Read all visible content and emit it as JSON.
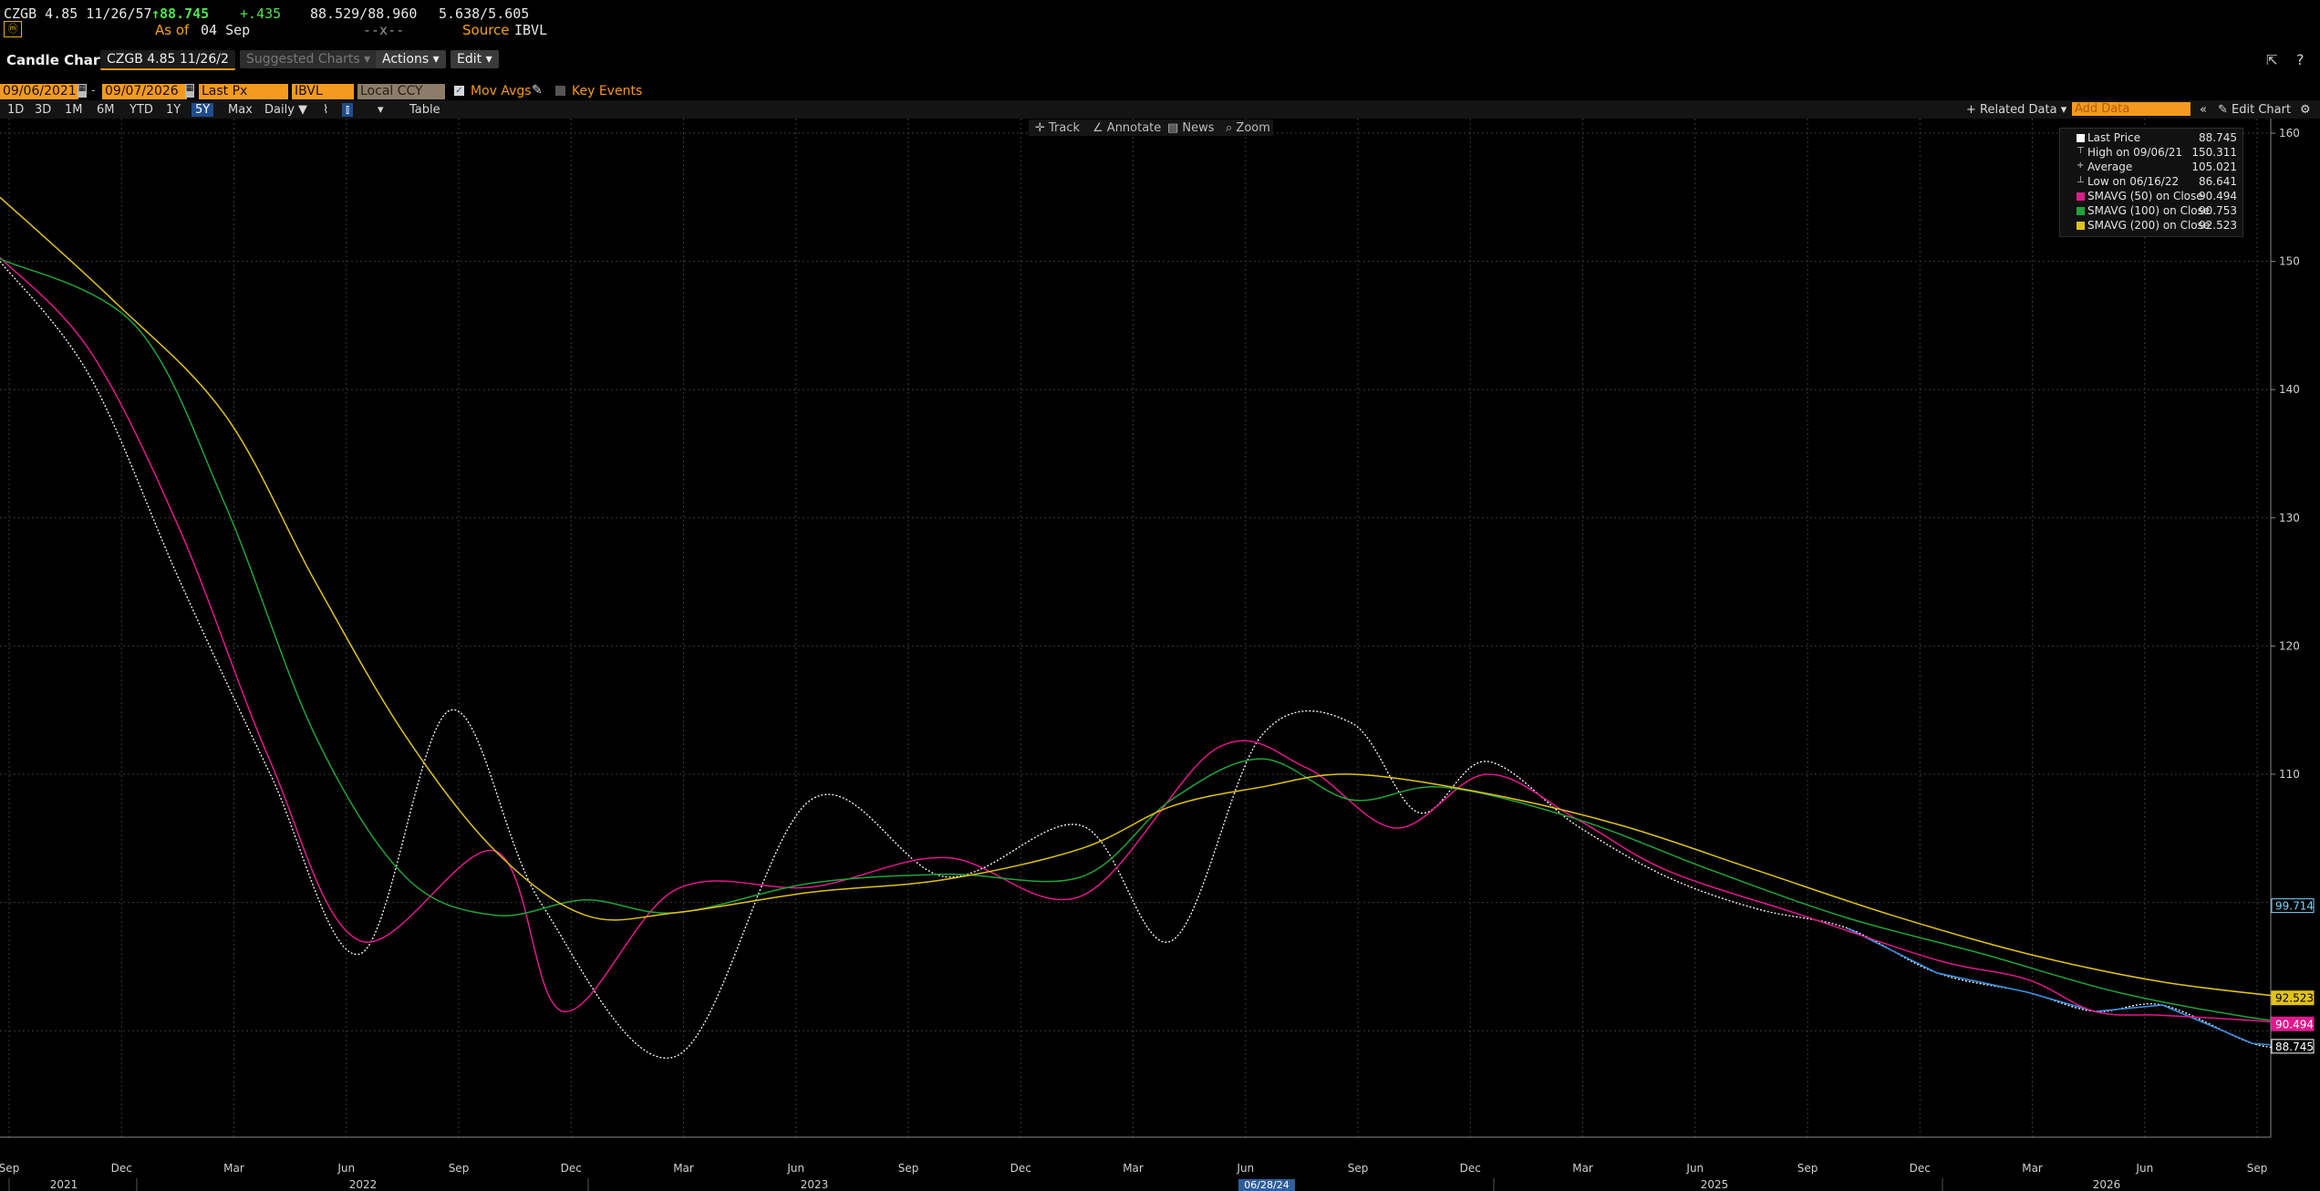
{
  "header": {
    "ticker": "CZGB 4.85 11/26/57",
    "last_price": "88.745",
    "change": "+.435",
    "bid_ask": "88.529/88.960",
    "yield": "5.638/5.605",
    "as_of_label": "As of",
    "as_of_date": "04 Sep",
    "dashes": "--x--",
    "source_label": "Source",
    "source_value": "IBVL"
  },
  "toolbar": {
    "title": "Candle Chart",
    "security_tab": "CZGB 4.85 11/26/2",
    "suggested_charts": "Suggested Charts",
    "actions": "Actions",
    "edit": "Edit"
  },
  "controls": {
    "start_date": "09/06/2021",
    "end_date": "09/07/2026",
    "field": "Last Px",
    "source": "IBVL",
    "currency": "Local CCY",
    "mov_avgs": "Mov Avgs",
    "key_events": "Key Events",
    "periods": [
      "1D",
      "3D",
      "1M",
      "6M",
      "YTD",
      "1Y",
      "5Y",
      "Max"
    ],
    "selected_period": "5Y",
    "frequency": "Daily",
    "table": "Table",
    "related_data": "Related Data",
    "add_data_placeholder": "Add Data",
    "edit_chart": "Edit Chart"
  },
  "chart_tools": [
    "Track",
    "Annotate",
    "News",
    "Zoom"
  ],
  "colors": {
    "price": "#ffffff",
    "recent_price": "#3b8fe0",
    "sma50": "#e0198c",
    "sma100": "#21a33a",
    "sma200": "#e0c21a",
    "accent": "#f59a1e"
  },
  "icons": [
    "calendar-icon",
    "pencil-icon",
    "checkbox-icon",
    "popout-icon",
    "help-icon",
    "gear-icon",
    "double-chevron-icon"
  ],
  "chart_data": {
    "type": "line",
    "ylim": [
      80,
      162
    ],
    "yticks": [
      110,
      120,
      130,
      140,
      150,
      160
    ],
    "grid": true,
    "legend_position": "top-right",
    "x_month_labels": [
      "Sep",
      "Dec",
      "Mar",
      "Jun",
      "Sep",
      "Dec",
      "Mar",
      "Jun",
      "Sep",
      "Dec",
      "Mar",
      "Jun",
      "Sep",
      "Dec",
      "Mar",
      "Jun",
      "Sep",
      "Dec",
      "Mar",
      "Jun",
      "Sep"
    ],
    "x_year_labels": [
      "2021",
      "2022",
      "2023",
      "2025",
      "2026"
    ],
    "x_highlight_label": "06/28/24",
    "legend": [
      {
        "name": "Last Price",
        "value": "88.745",
        "color": "#ffffff"
      },
      {
        "name": "High on 09/06/21",
        "value": "150.311",
        "color": ""
      },
      {
        "name": "Average",
        "value": "105.021",
        "color": ""
      },
      {
        "name": "Low on 06/16/22",
        "value": "86.641",
        "color": ""
      },
      {
        "name": "SMAVG (50)  on Close",
        "value": "90.494",
        "color": "#e0198c"
      },
      {
        "name": "SMAVG (100)  on Close",
        "value": "90.753",
        "color": "#21a33a"
      },
      {
        "name": "SMAVG (200)  on Close",
        "value": "92.523",
        "color": "#e0c21a"
      }
    ],
    "axis_tags": [
      {
        "value": "99.714",
        "y": 99.714,
        "bg": "#000000",
        "fg": "#7fd4ff",
        "border": "#7fd4ff"
      },
      {
        "value": "92.523",
        "y": 92.523,
        "bg": "#e0c21a",
        "fg": "#000000",
        "border": "#e0c21a"
      },
      {
        "value": "90.494",
        "y": 90.494,
        "bg": "#e0198c",
        "fg": "#ffffff",
        "border": "#e0198c"
      },
      {
        "value": "88.745",
        "y": 88.745,
        "bg": "#000000",
        "fg": "#ffffff",
        "border": "#ffffff"
      }
    ],
    "series": [
      {
        "name": "Last Price",
        "color": "#ffffff",
        "x": [
          0,
          0.04,
          0.08,
          0.12,
          0.16,
          0.2,
          0.24,
          0.3,
          0.36,
          0.42,
          0.48,
          0.52,
          0.56,
          0.6,
          0.63,
          0.66,
          0.7,
          0.74,
          0.78,
          0.82,
          0.86,
          0.9,
          0.93,
          0.96,
          1.0,
          1.02
        ],
        "values": [
          150,
          141,
          125,
          110,
          96,
          115,
          100,
          88,
          108,
          102,
          106,
          97,
          113,
          114,
          107,
          111,
          106,
          102,
          99.5,
          98,
          94.5,
          93,
          91.5,
          92,
          89,
          88.745
        ]
      },
      {
        "name": "SMAVG (50)",
        "color": "#e0198c",
        "x": [
          0,
          0.04,
          0.08,
          0.12,
          0.16,
          0.22,
          0.25,
          0.3,
          0.36,
          0.42,
          0.48,
          0.54,
          0.58,
          0.62,
          0.66,
          0.7,
          0.74,
          0.8,
          0.86,
          0.9,
          0.93,
          0.96,
          1.0,
          1.02
        ],
        "values": [
          150.3,
          143,
          129,
          111,
          97,
          104,
          91.5,
          101,
          101.2,
          103.5,
          100.5,
          112,
          110.5,
          105.8,
          110,
          106.5,
          102.5,
          99,
          95.5,
          94,
          91.5,
          91.2,
          90.8,
          90.494
        ]
      },
      {
        "name": "SMAVG (100)",
        "color": "#21a33a",
        "x": [
          0,
          0.06,
          0.1,
          0.14,
          0.18,
          0.22,
          0.26,
          0.3,
          0.36,
          0.42,
          0.48,
          0.52,
          0.56,
          0.6,
          0.64,
          0.7,
          0.76,
          0.82,
          0.88,
          0.94,
          1.0,
          1.02
        ],
        "values": [
          150.2,
          145,
          131,
          113,
          102,
          99,
          100.2,
          99.2,
          101.5,
          102.2,
          102,
          108,
          111.2,
          108,
          109,
          106.5,
          102.5,
          98.8,
          96,
          93,
          91,
          90.753
        ]
      },
      {
        "name": "SMAVG (200)",
        "color": "#e0c21a",
        "x": [
          0,
          0.05,
          0.1,
          0.14,
          0.18,
          0.22,
          0.26,
          0.3,
          0.36,
          0.42,
          0.48,
          0.52,
          0.56,
          0.6,
          0.66,
          0.72,
          0.78,
          0.84,
          0.9,
          0.96,
          1.02
        ],
        "values": [
          155,
          147,
          138,
          125,
          113,
          104,
          99,
          99.2,
          100.8,
          101.8,
          104.2,
          107.5,
          109,
          110,
          108.5,
          106,
          102.5,
          99,
          96,
          93.8,
          92.523
        ]
      }
    ]
  }
}
